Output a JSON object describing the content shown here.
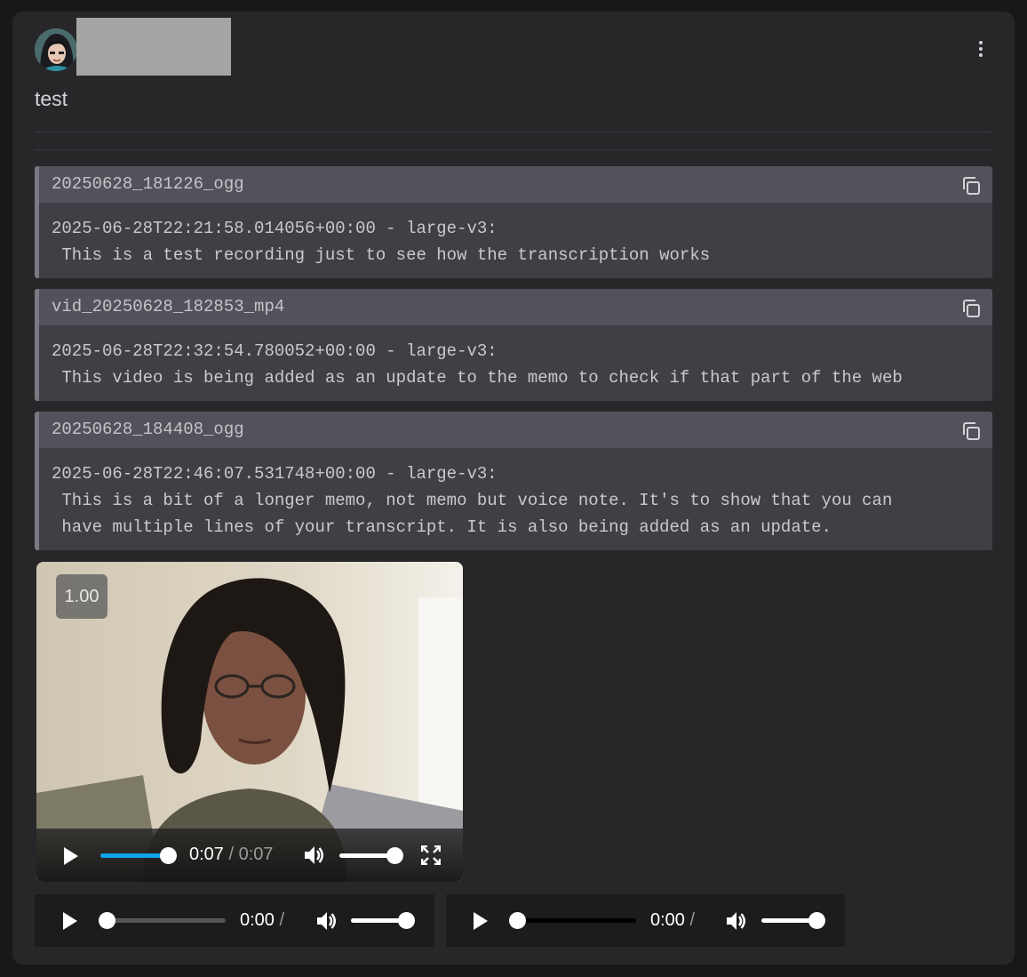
{
  "post": {
    "title": "test"
  },
  "transcripts": [
    {
      "filename": "20250628_181226_ogg",
      "header": "2025-06-28T22:21:58.014056+00:00 - large-v3:",
      "lines": [
        " This is a test recording just to see how the transcription works"
      ]
    },
    {
      "filename": "vid_20250628_182853_mp4",
      "header": "2025-06-28T22:32:54.780052+00:00 - large-v3:",
      "lines": [
        " This video is being added as an update to the memo to check if that part of the web"
      ]
    },
    {
      "filename": "20250628_184408_ogg",
      "header": "2025-06-28T22:46:07.531748+00:00 - large-v3:",
      "lines": [
        " This is a bit of a longer memo, not memo but voice note. It's to show that you can",
        " have multiple lines of your transcript. It is also being added as an update."
      ]
    }
  ],
  "video_player": {
    "speed": "1.00",
    "current_time": "0:07",
    "separator": " / ",
    "duration": "0:07",
    "progress": 1.0,
    "volume": 1.0
  },
  "audio_players": [
    {
      "current_time": "0:00",
      "separator": " /",
      "progress": 0.0,
      "volume": 1.0
    },
    {
      "current_time": "0:00",
      "separator": " /",
      "progress": 0.0,
      "volume": 1.0
    }
  ],
  "colors": {
    "accent": "#0ea5e9",
    "card_bg": "#27272a",
    "block_bg": "#3f3f46",
    "block_header_bg": "#52525b"
  },
  "icons": [
    "kebab-menu-icon",
    "copy-icon",
    "play-icon",
    "volume-icon",
    "fullscreen-icon"
  ]
}
